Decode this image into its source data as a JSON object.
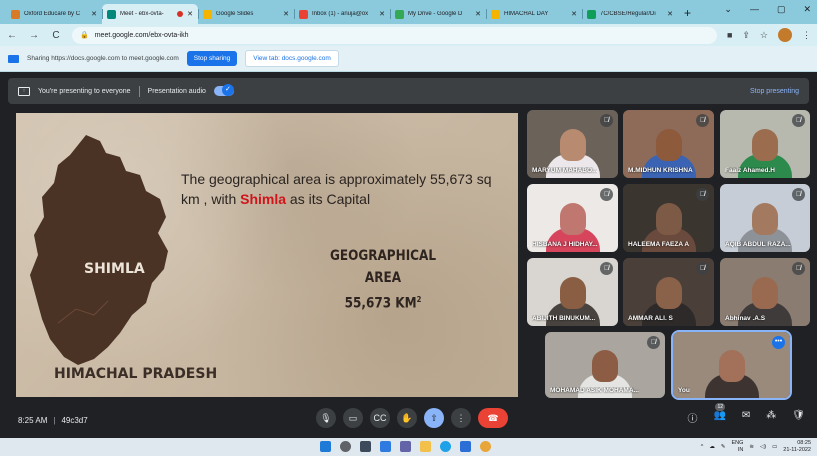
{
  "browser": {
    "tabs": [
      {
        "title": "Oxford Educare by C",
        "favicon_color": "#d97a26",
        "active": false
      },
      {
        "title": "Meet - ebx-ovta-",
        "favicon_color": "#00897b",
        "active": true,
        "recording": true
      },
      {
        "title": "Google Slides",
        "favicon_color": "#f4b400",
        "active": false
      },
      {
        "title": "Inbox (1) - anuja@ox",
        "favicon_color": "#ea4335",
        "active": false
      },
      {
        "title": "My Drive - Google D",
        "favicon_color": "#34a853",
        "active": false
      },
      {
        "title": "HIMACHAL DAY",
        "favicon_color": "#f4b400",
        "active": false
      },
      {
        "title": "7C/CBSE/Regular/Di",
        "favicon_color": "#0f9d58",
        "active": false
      }
    ],
    "new_tab": "+",
    "url": "meet.google.com/ebx-ovta-ikh"
  },
  "sharing_bar": {
    "text": "Sharing https://docs.google.com to meet.google.com",
    "stop_label": "Stop sharing",
    "view_label": "View tab: docs.google.com"
  },
  "present_bar": {
    "status": "You're presenting to everyone",
    "audio_label": "Presentation audio",
    "stop_label": "Stop presenting"
  },
  "slide": {
    "capital_marker": "SHIMLA",
    "state_label": "HIMACHAL PRADESH",
    "statement_prefix": "The geographical area is approximately 55,673 sq km , with ",
    "statement_capital": "Shimla",
    "statement_suffix": "  as its Capital",
    "geo_title": "GEOGRAPHICAL AREA",
    "geo_value": "55,673 KM",
    "geo_sup": "2"
  },
  "participants": [
    {
      "name": "MARYUM MAHABO...",
      "bg": "#6b6259",
      "skin": "#b88a70",
      "clothes": "#ece7ea",
      "muted": true
    },
    {
      "name": "M.MIDHUN KRISHNA",
      "bg": "#8e6b58",
      "skin": "#8d5a3c",
      "clothes": "#3a64b3",
      "muted": true
    },
    {
      "name": "Faaiz Ahamed.H",
      "bg": "#b7b8ae",
      "skin": "#9b6d4e",
      "clothes": "#2d8a4d",
      "muted": true
    },
    {
      "name": "HISBANA J HIDHAY...",
      "bg": "#ece9e6",
      "skin": "#c0776f",
      "clothes": "#d6455c",
      "muted": true
    },
    {
      "name": "HALEEMA FAEZA A",
      "bg": "#3b3530",
      "skin": "#7d5a45",
      "clothes": "#6a4a3d",
      "muted": true
    },
    {
      "name": "AQIB ABDUL RAZA...",
      "bg": "#c7cdd6",
      "skin": "#a37a60",
      "clothes": "#8d9298",
      "muted": true
    },
    {
      "name": "ABIJITH BINUKUM...",
      "bg": "#d9d5d0",
      "skin": "#8a5e43",
      "clothes": "#49433f",
      "muted": true
    },
    {
      "name": "AMMAR ALI. S",
      "bg": "#4b4039",
      "skin": "#8a6149",
      "clothes": "#2e2a2a",
      "muted": true
    },
    {
      "name": "Abhinav .A.S",
      "bg": "#8a7c70",
      "skin": "#9a6a50",
      "clothes": "#3f3b3a",
      "muted": true
    },
    {
      "name": "MOHAMAD ASIK MOHAMA...",
      "bg": "#aaa59e",
      "skin": "#8c5d44",
      "clothes": "#e4e4e2",
      "muted": true
    },
    {
      "name": "You",
      "bg": "#9a8a7c",
      "skin": "#a3705a",
      "clothes": "#3d3432",
      "muted": false,
      "self": true
    }
  ],
  "bottom_bar": {
    "time": "8:25 AM",
    "meeting_code": "49c3d7",
    "participant_count": "12"
  },
  "taskbar": {
    "lang": "ENG",
    "region": "IN",
    "clock_time": "08:25",
    "clock_date": "21-11-2022"
  },
  "colors": {
    "accent": "#1a73e8",
    "end_call": "#ea4335",
    "meet_bg": "#202124",
    "map_fill": "#4a3224"
  }
}
